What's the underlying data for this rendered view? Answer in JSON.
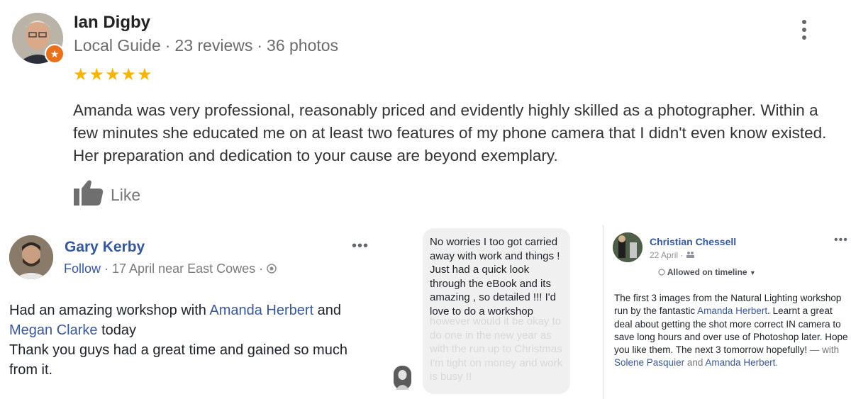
{
  "google_review": {
    "author": "Ian Digby",
    "role": "Local Guide",
    "reviews": "23 reviews",
    "photos": "36 photos",
    "separator": "·",
    "stars": "★★★★★",
    "rating": 5,
    "text": "Amanda was very professional, reasonably priced and evidently highly skilled as a photographer. Within a few minutes she educated me on at least two features of my phone camera that I didn't even know existed. Her preparation and dedication to your cause are beyond exemplary.",
    "like_label": "Like",
    "badge_icon": "star-icon"
  },
  "fb_post_1": {
    "author": "Gary Kerby",
    "follow": "Follow",
    "meta": "· 17 April near East Cowes ·",
    "menu": "•••",
    "text_1": "Had an amazing workshop with ",
    "mention_1": "Amanda Herbert",
    "text_2": " and ",
    "mention_2": "Megan Clarke",
    "text_3": " today",
    "text_4": "Thank you guys had a great time and gained so much from it."
  },
  "message": {
    "visible_text": "No worries I too got carried away with work and things ! Just had a quick look through the eBook and its amazing , so detailed !!! I'd love to do a workshop",
    "faded_text": "however would it be okay to do one in the new year as with the run up to Christmas I'm tight on money and work is busy !!"
  },
  "fb_post_2": {
    "author": "Christian Chessell",
    "date": "22 April ·",
    "menu": "•••",
    "privacy": "Allowed on timeline",
    "text_1": "The first 3 images from the Natural Lighting workshop run by the fantastic ",
    "mention_1": "Amanda Herbert",
    "text_2": ". Learnt a great deal about getting the shot more correct IN camera to save long hours and over use of Photoshop later. Hope you like them. The next 3 tomorrow hopefully!",
    "with_label": " — with ",
    "mention_2": "Solene Pasquier",
    "and_label": " and ",
    "mention_3": "Amanda Herbert",
    "end": "."
  },
  "colors": {
    "fb_link": "#385898",
    "star": "#f7b400",
    "badge": "#e8711c"
  }
}
